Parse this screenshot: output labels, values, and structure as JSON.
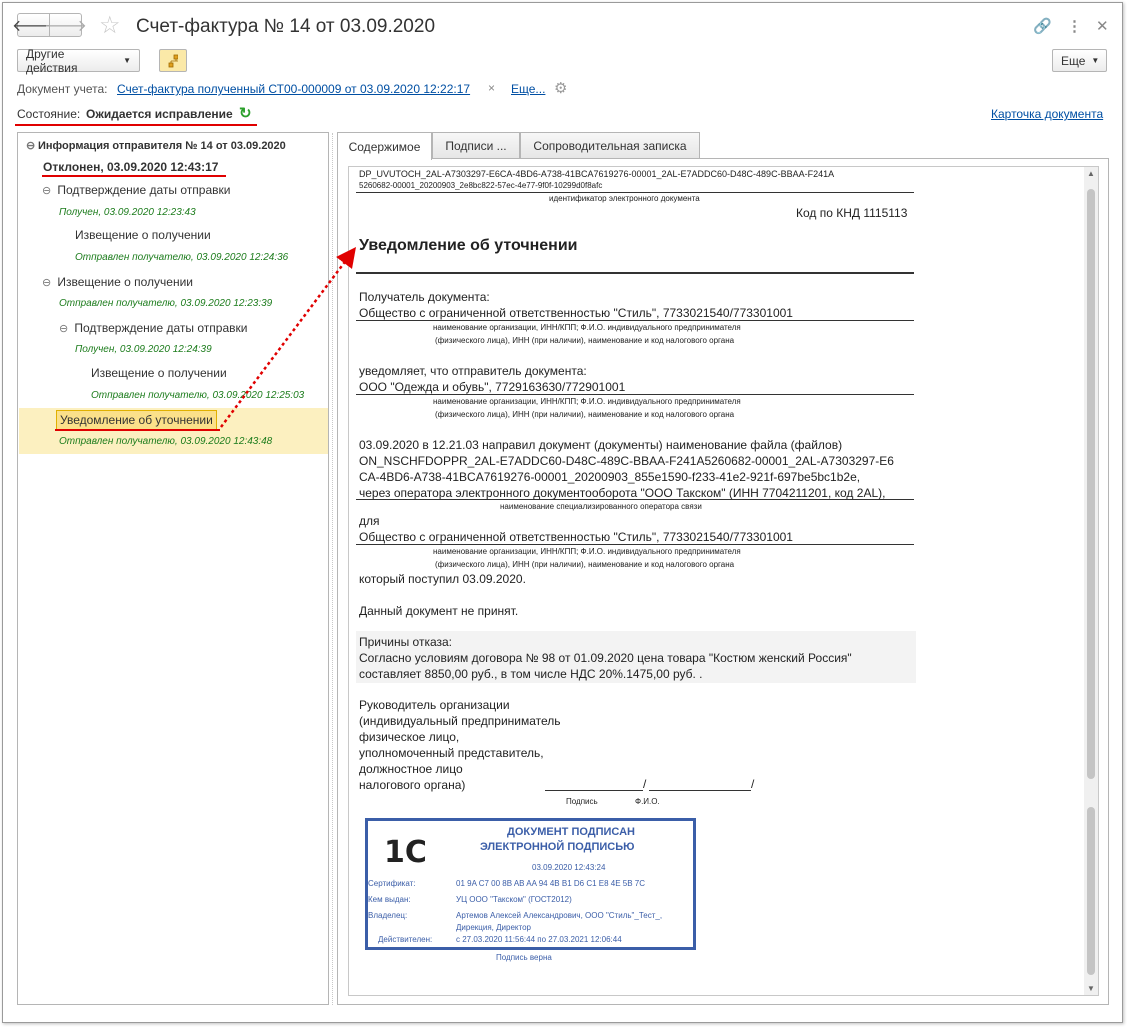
{
  "window": {
    "title": "Счет-фактура № 14 от 03.09.2020"
  },
  "toolbar": {
    "other_actions": "Другие действия",
    "more": "Еще"
  },
  "doc_info": {
    "label": "Документ учета:",
    "link": "Счет-фактура полученный СТ00-000009 от 03.09.2020 12:22:17",
    "more_link": "Еще..."
  },
  "state": {
    "label": "Состояние:",
    "value": "Ожидается исправление",
    "card_link": "Карточка документа"
  },
  "tree": {
    "root": "Информация отправителя № 14 от 03.09.2020",
    "root_status": "Отклонен, 03.09.2020 12:43:17",
    "items": [
      {
        "label": "Подтверждение даты отправки",
        "sub": "Получен, 03.09.2020 12:23:43"
      },
      {
        "label": "Извещение о получении",
        "sub": "Отправлен получателю, 03.09.2020 12:24:36"
      },
      {
        "label": "Извещение о получении",
        "sub": "Отправлен получателю, 03.09.2020 12:23:39"
      },
      {
        "label": "Подтверждение даты отправки",
        "sub": "Получен, 03.09.2020 12:24:39"
      },
      {
        "label": "Извещение о получении",
        "sub": "Отправлен получателю, 03.09.2020 12:25:03"
      },
      {
        "label": "Уведомление об уточнении",
        "sub": "Отправлен получателю, 03.09.2020 12:43:48"
      }
    ]
  },
  "tabs": [
    "Содержимое",
    "Подписи ...",
    "Сопроводительная записка"
  ],
  "document": {
    "id_line1": "DP_UVUTOCH_2AL-A7303297-E6CA-4BD6-A738-41BCA7619276-00001_2AL-E7ADDC60-D48C-489C-BBAA-F241A",
    "id_line2": "5260682-00001_20200903_2e8bc822-57ec-4e77-9f0f-10299d0f8afc",
    "id_caption": "идентификатор электронного документа",
    "knd": "Код по КНД 1115113",
    "heading": "Уведомление об уточнении",
    "recipient_label": "Получатель документа:",
    "recipient": "Общество с ограниченной ответственностью \"Стиль\", 7733021540/773301001",
    "caption_org1": "наименование организации, ИНН/КПП; Ф.И.О. индивидуального предпринимателя",
    "caption_org2": "(физического лица), ИНН (при наличии), наименование и код налогового органа",
    "notify_label": "уведомляет, что отправитель документа:",
    "sender": "ООО \"Одежда и обувь\", 7729163630/772901001",
    "sent_line1": "03.09.2020 в 12.21.03 направил документ (документы) наименование файла (файлов)",
    "sent_line2": "ON_NSCHFDOPPR_2AL-E7ADDC60-D48C-489C-BBAA-F241A5260682-00001_2AL-A7303297-E6",
    "sent_line3": "CA-4BD6-A738-41BCA7619276-00001_20200903_855e1590-f233-41e2-921f-697be5bc1b2e,",
    "sent_line4": "через оператора электронного документооборота \"ООО Такском\" (ИНН 7704211201, код 2AL),",
    "caption_operator": "наименование специализированного оператора связи",
    "for_label": "для",
    "for_org": "Общество с ограниченной ответственностью \"Стиль\", 7733021540/773301001",
    "received": "который поступил 03.09.2020.",
    "not_accepted": "Данный документ не принят.",
    "reason_label": "Причины отказа:",
    "reason_line1": "Согласно условиям договора № 98 от 01.09.2020 цена товара \"Костюм женский Россия\"",
    "reason_line2": "составляет 8850,00 руб., в том числе НДС 20%.1475,00 руб. .",
    "head_lines": [
      "Руководитель  организации",
      "(индивидуальный предприниматель",
      "физическое лицо,",
      "уполномоченный представитель,",
      "должностное лицо",
      "налогового органа)"
    ],
    "sign_slash1": "/",
    "sign_slash2": "/",
    "sign_caption": "Подпись",
    "fio_caption": "Ф.И.О.",
    "verified": "Подпись верна"
  },
  "stamp": {
    "logo": "1С",
    "title1": "ДОКУМЕНТ ПОДПИСАН",
    "title2": "ЭЛЕКТРОННОЙ ПОДПИСЬЮ",
    "datetime": "03.09.2020 12:43:24",
    "cert_label": "Сертификат:",
    "cert": "01 9A C7 00 8B AB AA 94 4B B1 D6 C1 E8 4E 5B 7C",
    "issuer_label": "Кем выдан:",
    "issuer": "УЦ ООО \"Такском\" (ГОСТ2012)",
    "owner_label": "Владелец:",
    "owner1": "Артемов Алексей Александрович, ООО \"Стиль\"_Тест_,",
    "owner2": "Дирекция, Директор",
    "valid_label": "Действителен:",
    "valid": "с 27.03.2020 11:56:44 по 27.03.2021 12:06:44"
  },
  "colors": {
    "link": "#004fa3",
    "status_green": "#1c7c1c",
    "highlight_red": "#e00000",
    "selection": "#fcf0c0",
    "stamp_blue": "#3b5ea8"
  }
}
